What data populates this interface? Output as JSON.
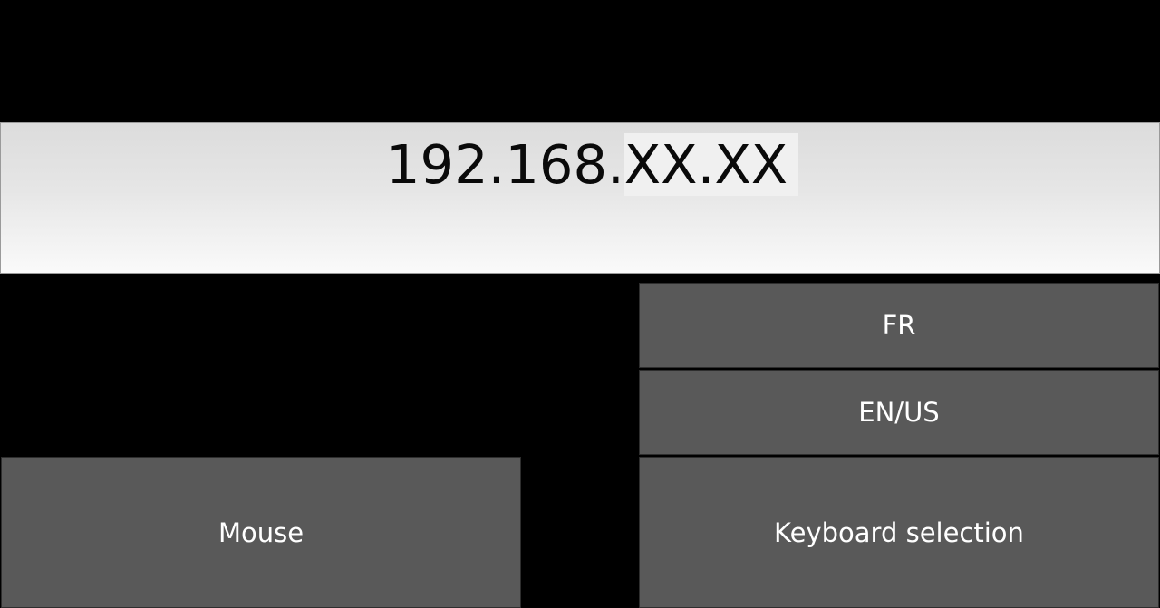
{
  "address": {
    "visible_prefix": "192.168.",
    "masked_suffix": "XX.XX"
  },
  "keyboard_layouts": [
    {
      "label": "FR"
    },
    {
      "label": "EN/US"
    }
  ],
  "buttons": {
    "keyboard_selection": "Keyboard selection",
    "mouse": "Mouse"
  },
  "colors": {
    "background": "#000000",
    "button": "#595959",
    "button_text": "#ffffff",
    "address_text": "#0a0a0a"
  }
}
